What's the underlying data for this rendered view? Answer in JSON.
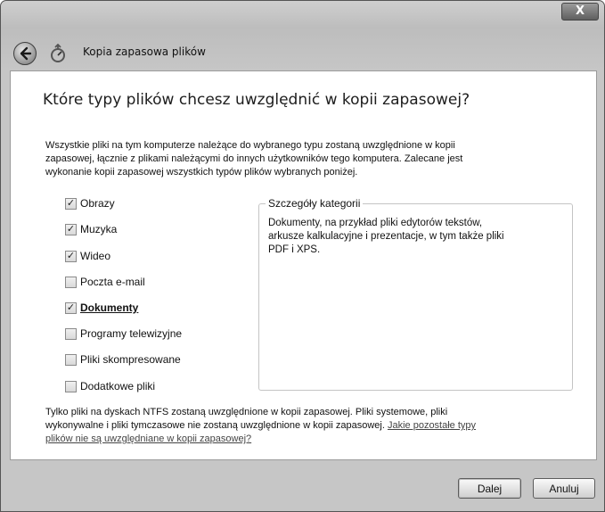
{
  "window": {
    "title": "Kopia zapasowa plików",
    "close_label": "X"
  },
  "page": {
    "heading": "Które typy plików chcesz uwzględnić w kopii zapasowej?",
    "intro_lines": [
      "Wszystkie pliki na tym komputerze należące do wybranego typu zostaną uwzględnione w kopii",
      "zapasowej, łącznie z plikami należącymi do innych użytkowników tego komputera. Zalecane jest",
      "wykonanie kopii zapasowej wszystkich typów plików wybranych poniżej."
    ]
  },
  "categories": [
    {
      "label": "Obrazy",
      "checked": true
    },
    {
      "label": "Muzyka",
      "checked": true
    },
    {
      "label": "Wideo",
      "checked": true
    },
    {
      "label": "Poczta e-mail",
      "checked": false
    },
    {
      "label": "Dokumenty",
      "checked": true,
      "selected": true
    },
    {
      "label": "Programy telewizyjne",
      "checked": false
    },
    {
      "label": "Pliki skompresowane",
      "checked": false
    },
    {
      "label": "Dodatkowe pliki",
      "checked": false
    }
  ],
  "details": {
    "legend": "Szczegóły kategorii",
    "lines": [
      "Dokumenty, na przykład pliki edytorów tekstów,",
      "arkusze kalkulacyjne i prezentacje, w tym także pliki",
      "PDF i XPS."
    ]
  },
  "note": {
    "line1": "Tylko pliki na dyskach NTFS zostaną uwzględnione w kopii zapasowej. Pliki systemowe, pliki",
    "line2_text": "wykonywalne i pliki tymczasowe nie zostaną uwzględnione w kopii zapasowej. ",
    "line2_link": "Jakie pozostałe typy",
    "line3_link": "plików nie są uwzględniane w kopii zapasowej?"
  },
  "buttons": {
    "next": "Dalej",
    "cancel": "Anuluj"
  },
  "icons": {
    "check_glyph": "✓"
  }
}
